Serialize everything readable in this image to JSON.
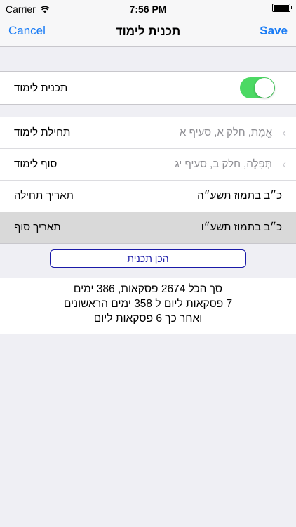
{
  "status_bar": {
    "carrier": "Carrier",
    "time": "7:56 PM"
  },
  "nav": {
    "cancel_label": "Cancel",
    "title": "תכנית לימוד",
    "save_label": "Save"
  },
  "toggle_row": {
    "label": "תכנית לימוד",
    "enabled": true
  },
  "rows": [
    {
      "label": "תחילת לימוד",
      "value": "אֱמֶת, חלק א, סעיף א"
    },
    {
      "label": "סוף לימוד",
      "value": "תְּפִלָּה, חלק ב, סעיף יג"
    },
    {
      "label": "תאריך תחילה",
      "value": "כ״ב בתמוז תשע״ה"
    },
    {
      "label": "תאריך סוף",
      "value": "כ״ב בתמוז תשע״ו"
    }
  ],
  "make_plan_button": "הכן תכנית",
  "summary": {
    "line1": "סך הכל 2674 פסקאות, 386 ימים",
    "line2": "7 פסקאות ליום  ל 358 ימים הראשונים",
    "line3": "ואחר כך 6 פסקאות ליום"
  },
  "colors": {
    "accent": "#1a7cf5",
    "toggle_on": "#4cd964",
    "button_border": "#1a1aa8"
  }
}
